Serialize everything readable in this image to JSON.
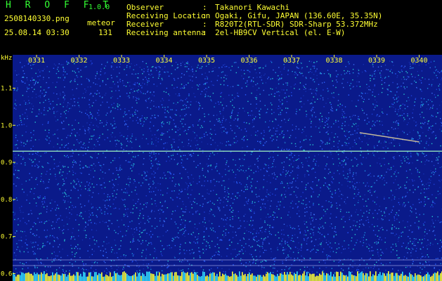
{
  "header": {
    "app_title": "H R O F F T",
    "version": "1.0.0",
    "file_name": "2508140330.png",
    "mode": "meteor",
    "datetime": "25.08.14 03:30",
    "count": "131",
    "fields": [
      {
        "label": "Observer",
        "value": "Takanori Kawachi"
      },
      {
        "label": "Receiving Location",
        "value": "Ogaki, Gifu, JAPAN (136.60E, 35.35N)"
      },
      {
        "label": "Receiver",
        "value": "R820T2(RTL-SDR) SDR-Sharp 53.372MHz"
      },
      {
        "label": "Receiving antenna",
        "value": "2el-HB9CV Vertical (el. E-W)"
      }
    ]
  },
  "spectrogram": {
    "unit_label": "kHz",
    "time_ticks": [
      "0331",
      "0332",
      "0333",
      "0334",
      "0335",
      "0336",
      "0337",
      "0338",
      "0339",
      "0340"
    ],
    "freq_ticks": [
      "1.1",
      "1.0",
      "0.9",
      "0.8",
      "0.7",
      "0.6"
    ],
    "freq_range_khz": [
      0.58,
      1.19
    ],
    "carrier_khz": 0.93,
    "meteor_echo": {
      "start_minute": 8.6,
      "end_minute": 10.0,
      "start_khz": 0.98,
      "end_khz": 0.955
    },
    "colors": {
      "background": "#0a1a8a",
      "label_yellow": "#ffff33",
      "label_green": "#33ff33"
    }
  }
}
